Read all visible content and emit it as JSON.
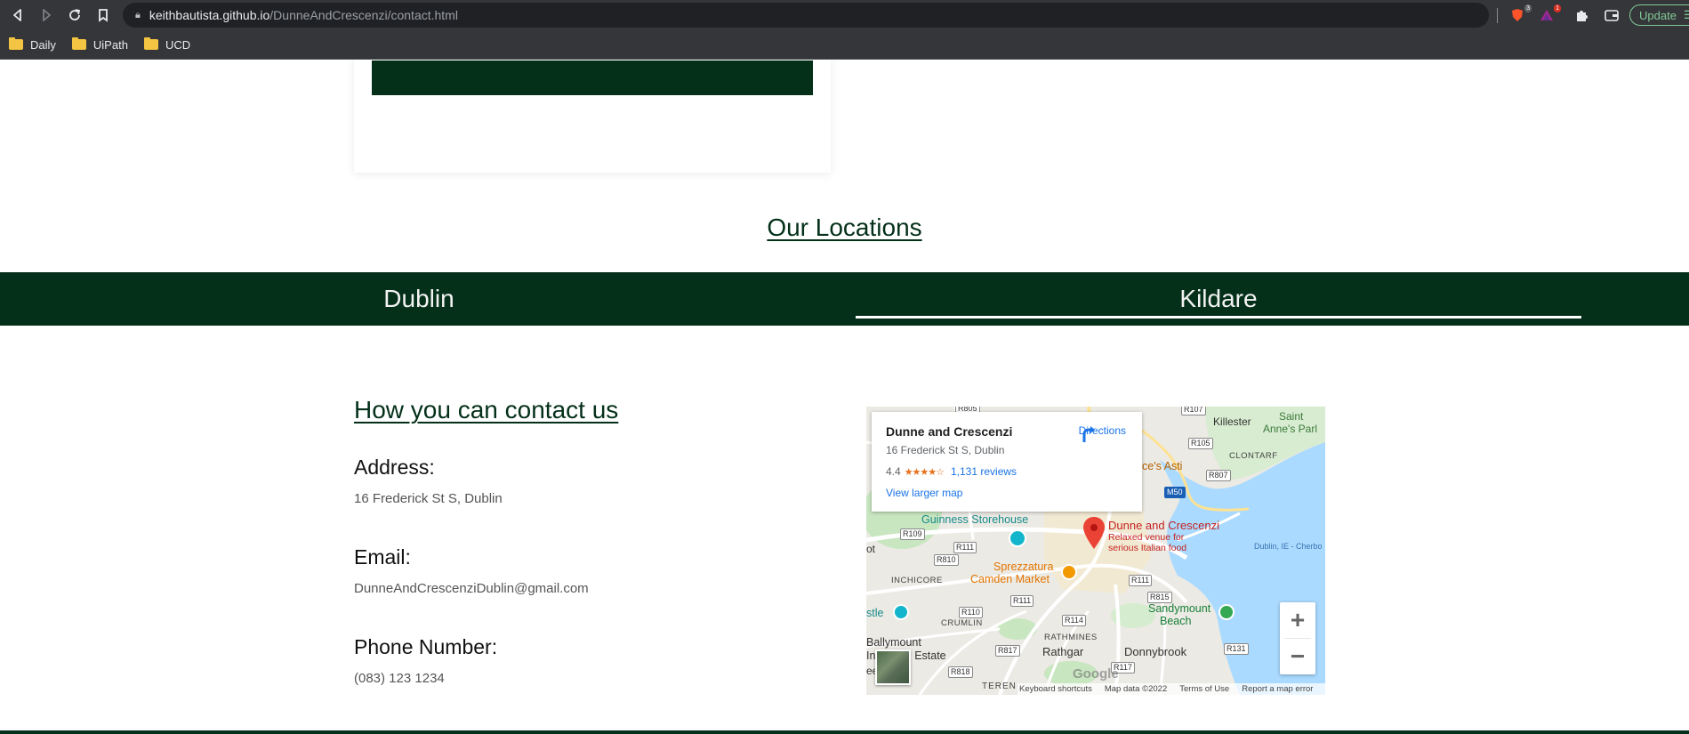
{
  "browser": {
    "url_host": "keithbautista.github.io",
    "url_path": "/DunneAndCrescenzi/contact.html",
    "update_label": "Update",
    "bookmarks": [
      {
        "label": "Daily"
      },
      {
        "label": "UiPath"
      },
      {
        "label": "UCD"
      }
    ],
    "ext_badges": {
      "brave": "3",
      "bat": "1"
    }
  },
  "locations": {
    "title": "Our Locations",
    "tabs": [
      {
        "label": "Dublin"
      },
      {
        "label": "Kildare"
      }
    ],
    "active_tab": "Kildare"
  },
  "contact": {
    "title": "How you can contact us",
    "address_label": "Address:",
    "address_value": "16 Frederick St S, Dublin",
    "email_label": "Email:",
    "email_value": "DunneAndCrescenziDublin@gmail.com",
    "phone_label": "Phone Number:",
    "phone_value": "(083) 123 1234"
  },
  "map": {
    "place_name": "Dunne and Crescenzi",
    "place_address": "16 Frederick St S, Dublin",
    "rating": "4.4",
    "stars": "★★★★☆",
    "reviews": "1,131 reviews",
    "directions_label": "Directions",
    "view_larger": "View larger map",
    "pin_title": "Dunne and Crescenzi",
    "pin_sub1": "Relaxed venue for",
    "pin_sub2": "serious Italian food",
    "poi": {
      "guinness": "Guinness Storehouse",
      "sprezzatura1": "Sprezzatura",
      "sprezzatura2": "Camden Market",
      "sandymount1": "Sandymount",
      "sandymount2": "Beach",
      "castle": "stle",
      "ces_asti": "ce's Asti"
    },
    "labels": {
      "killester": "Killester",
      "saint_annes1": "Saint",
      "saint_annes2": "Anne's Parl",
      "clontarf": "CLONTARF",
      "inchicore": "INCHICORE",
      "crumlin": "CRUMLIN",
      "rathmines": "RATHMINES",
      "rathgar": "Rathgar",
      "donnybrook": "Donnybrook",
      "ballymount1": "Ballymount",
      "ballymount2": "Industrial Estate",
      "dublin_port": "Dublin, IE - Cherbo",
      "terenure": "TEREN",
      "ot": "ot",
      "ee": "ee"
    },
    "roads": [
      "R107",
      "R105",
      "R807",
      "M50",
      "R109",
      "R111",
      "R810",
      "R111",
      "R110",
      "R111",
      "R815",
      "R114",
      "R817",
      "R131",
      "R818",
      "R117",
      "R105",
      "R805"
    ],
    "footer": [
      "Keyboard shortcuts",
      "Map data ©2022",
      "Terms of Use",
      "Report a map error"
    ],
    "google": "Google",
    "zoom_in": "+",
    "zoom_out": "−"
  },
  "colors": {
    "brand_green": "#043019",
    "link_blue": "#1a73e8",
    "pin_red": "#ea4335"
  }
}
